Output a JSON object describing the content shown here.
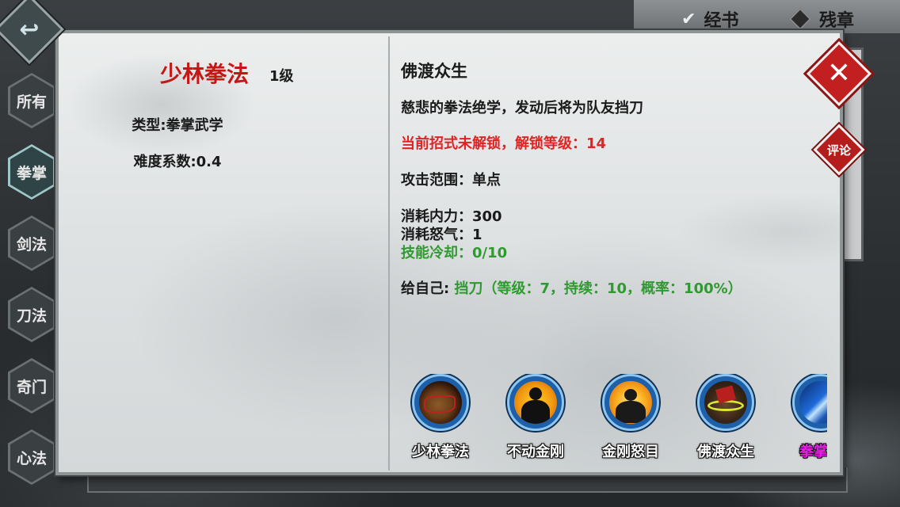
{
  "top_tabs": [
    {
      "label": "经书",
      "icon": "check-diamond-icon"
    },
    {
      "label": "残章",
      "icon": "diamond-icon"
    }
  ],
  "back_button": {
    "icon": "back-arrow-icon"
  },
  "categories": [
    {
      "label": "所有",
      "active": false
    },
    {
      "label": "拳掌",
      "active": true
    },
    {
      "label": "剑法",
      "active": false
    },
    {
      "label": "刀法",
      "active": false
    },
    {
      "label": "奇门",
      "active": false
    },
    {
      "label": "心法",
      "active": false
    }
  ],
  "martial": {
    "name": "少林拳法",
    "level": "1级",
    "type": "类型:拳掌武学",
    "difficulty": "难度系数:0.4"
  },
  "move": {
    "title": "佛渡众生",
    "description": "慈悲的拳法绝学，发动后将为队友挡刀",
    "lock_notice": "当前招式未解锁，解锁等级：14",
    "range": "攻击范围：单点",
    "mp_cost": "消耗内力：300",
    "rage_cost": "消耗怒气：1",
    "cooldown": "技能冷却：0/10",
    "self_effect_label": "给自己:",
    "self_effect_value": "挡刀（等级：7，持续：10，概率：100%）"
  },
  "buttons": {
    "close": "✕",
    "comment": "评论"
  },
  "skills": [
    {
      "name": "少林拳法",
      "icon": "fist-scroll-icon",
      "highlight": false
    },
    {
      "name": "不动金刚",
      "icon": "buddha-silhouette-icon",
      "highlight": false
    },
    {
      "name": "金刚怒目",
      "icon": "buddha-flame-icon",
      "highlight": false
    },
    {
      "name": "佛渡众生",
      "icon": "buddha-aura-icon",
      "highlight": false
    },
    {
      "name": "拳掌精",
      "icon": "blue-strike-icon",
      "highlight": true
    }
  ],
  "colors": {
    "title_red": "#c41818",
    "lock_red": "#e02424",
    "green": "#2f9a2f",
    "skill_ring": "#1d5fa8",
    "close_red": "#c22020"
  }
}
